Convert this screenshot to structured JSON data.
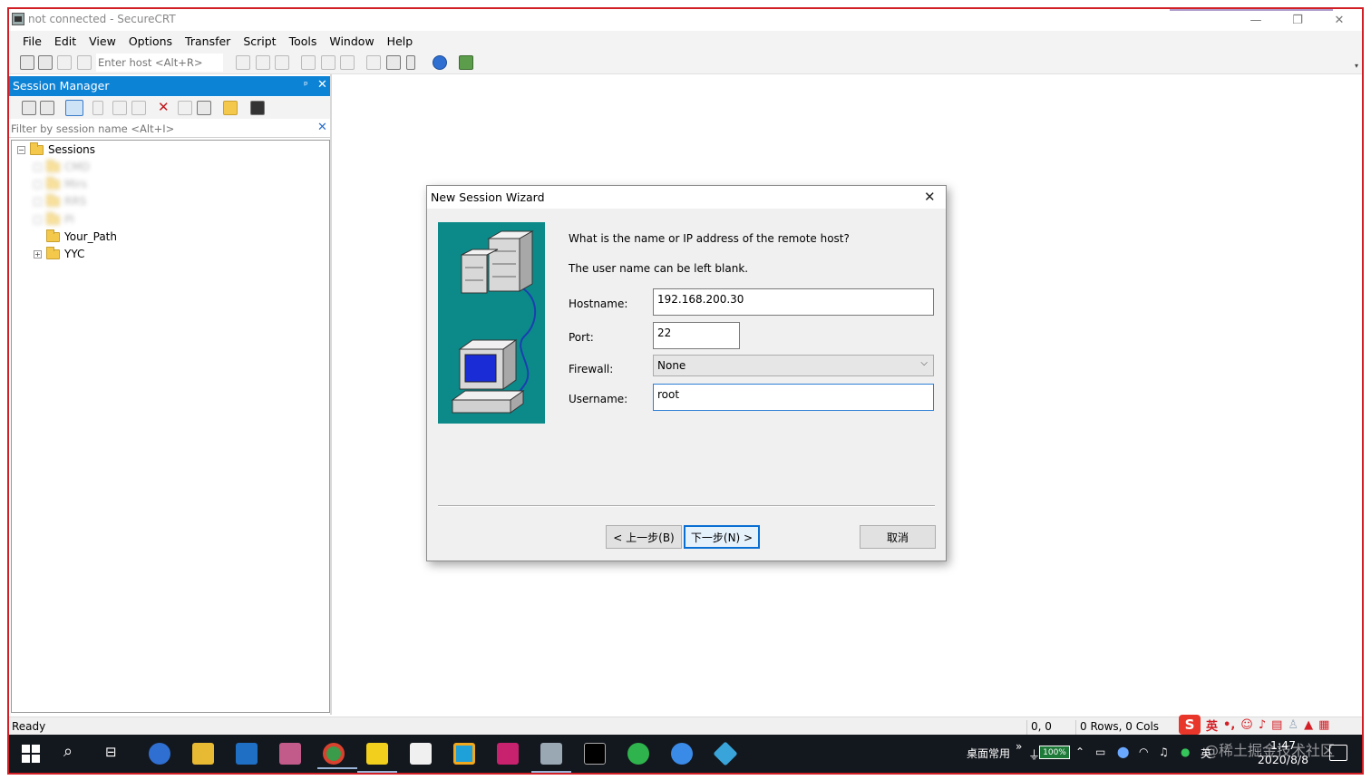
{
  "window": {
    "title": "not connected - SecureCRT",
    "minimize": "—",
    "maximize": "❐",
    "close": "✕"
  },
  "menu": [
    "File",
    "Edit",
    "View",
    "Options",
    "Transfer",
    "Script",
    "Tools",
    "Window",
    "Help"
  ],
  "toolbar": {
    "host_placeholder": "Enter host <Alt+R>"
  },
  "session_manager": {
    "title": "Session Manager",
    "pin": "ᵖ",
    "close": "✕",
    "filter_placeholder": "Filter by session name <Alt+I>",
    "filter_clear": "✕",
    "delete_glyph": "✕",
    "root": {
      "label": "Sessions",
      "expander": "−"
    },
    "blurred_items": [
      "CMD",
      "Mirs",
      "RRS",
      "PI"
    ],
    "items": [
      {
        "label": "Your_Path",
        "expander": ""
      },
      {
        "label": "YYC",
        "expander": "+"
      }
    ]
  },
  "dialog": {
    "title": "New Session Wizard",
    "close": "✕",
    "question": "What is the name or IP address of the remote host?",
    "note": "The user name can be left blank.",
    "hostname_label": "Hostname:",
    "hostname_value": "192.168.200.30",
    "port_label": "Port:",
    "port_value": "22",
    "firewall_label": "Firewall:",
    "firewall_value": "None",
    "username_label": "Username:",
    "username_value": "root",
    "back_button": "< 上一步(B)",
    "next_button": "下一步(N) >",
    "cancel_button": "取消"
  },
  "statusbar": {
    "status": "Ready",
    "position": "0, 0",
    "size": "0 Rows, 0 Cols",
    "ime_logo": "S",
    "ime_lang": "英"
  },
  "taskbar": {
    "desktop_label": "桌面常用",
    "overflow": "»",
    "battery": "100%",
    "tray_lang": "英",
    "time": "1:47",
    "date": "2020/8/8",
    "watermark": "@稀土掘金技术社区"
  },
  "colors": {
    "frame_border": "#d21f26",
    "session_header": "#0d83d6",
    "wizard_teal": "#0c8a8a",
    "primary_button_border": "#0a6fd3",
    "taskbar": "#13171e"
  }
}
